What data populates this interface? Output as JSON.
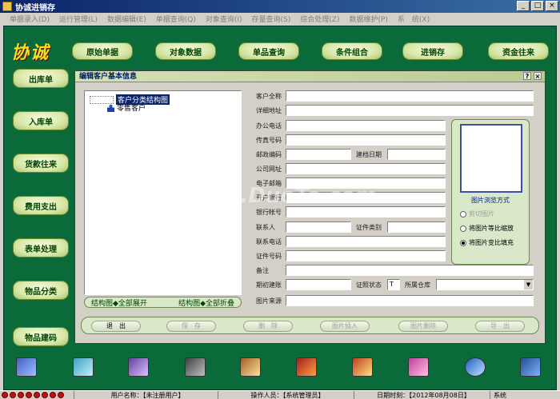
{
  "window": {
    "title": "协诚进销存"
  },
  "menu": [
    "单据录入(D)",
    "运行管理(L)",
    "数据编辑(E)",
    "单据查询(Q)",
    "对象查询(I)",
    "存量查询(S)",
    "综合处理(Z)",
    "数据维护(P)",
    "系　统(X)"
  ],
  "brand": {
    "logo_text": "协诚"
  },
  "top_nav": [
    "原始单据",
    "对象数据",
    "单品查询",
    "条件组合",
    "进销存",
    "资金往来"
  ],
  "side_nav": [
    "出库单",
    "入库单",
    "货款往来",
    "费用支出",
    "表单处理",
    "物品分类",
    "物品建码"
  ],
  "panel": {
    "title": "编辑客户基本信息",
    "pin": "?",
    "close": "×",
    "tree": {
      "root": "客户分类结构图",
      "children": [
        "零售客户"
      ]
    },
    "tree_actions": {
      "expand": "结构图◆全部展开",
      "collapse": "结构图◆全部折叠"
    },
    "labels": {
      "full_name": "客户全称",
      "address": "详细地址",
      "office_phone": "办公电话",
      "fax": "传真号码",
      "postcode": "邮政编码",
      "created": "建档日期",
      "website": "公司网址",
      "email": "电子邮箱",
      "bank": "开户银行",
      "account": "银行帐号",
      "contact": "联系人",
      "cert_type": "证件类别",
      "contact_phone": "联系电话",
      "cert_no": "证件号码",
      "remark": "备注",
      "period_start": "期初建账",
      "cert_status": "证照状态",
      "warehouse": "所属仓库",
      "image_source": "图片来源"
    },
    "values": {
      "cert_status": "T"
    },
    "image": {
      "title": "图片浏览方式",
      "options": [
        {
          "label": "剪切图片",
          "checked": false
        },
        {
          "label": "将图片等比缩放",
          "checked": false
        },
        {
          "label": "将图片变比填充",
          "checked": true
        }
      ]
    },
    "actions": [
      "退　出",
      "保　存",
      "删　除",
      "图片插入",
      "图片删除",
      "导　出"
    ]
  },
  "status_bar": {
    "company": "用户名称：【未注册用户】",
    "operator": "操作人员：【系统管理员】",
    "date": "日期时刻：【2012年08月08日】",
    "extra": "系统"
  },
  "colors": {
    "frame": "#0a6a3a",
    "button": "#d8e8a8",
    "accent": "#0a246a"
  },
  "watermark": "www.DuoTe.com"
}
